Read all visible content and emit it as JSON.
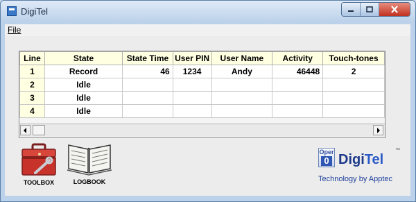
{
  "window": {
    "title": "DigiTel"
  },
  "menu": {
    "file": "File"
  },
  "table": {
    "columns": [
      "Line",
      "State",
      "State Time",
      "User PIN",
      "User Name",
      "Activity",
      "Touch-tones"
    ],
    "rows": [
      {
        "line": "1",
        "state": "Record",
        "state_time": "46",
        "user_pin": "1234",
        "user_name": "Andy",
        "activity": "46448",
        "touch_tones": "2"
      },
      {
        "line": "2",
        "state": "Idle",
        "state_time": "",
        "user_pin": "",
        "user_name": "",
        "activity": "",
        "touch_tones": ""
      },
      {
        "line": "3",
        "state": "Idle",
        "state_time": "",
        "user_pin": "",
        "user_name": "",
        "activity": "",
        "touch_tones": ""
      },
      {
        "line": "4",
        "state": "Idle",
        "state_time": "",
        "user_pin": "",
        "user_name": "",
        "activity": "",
        "touch_tones": ""
      }
    ]
  },
  "tools": {
    "toolbox": "TOOLBOX",
    "logbook": "LOGBOOK"
  },
  "logo": {
    "oper": "Oper",
    "zero": "0",
    "brand_digi": "Digi",
    "brand_tel": "Tel",
    "trademark": "™",
    "byline": "Technology by Apptec"
  },
  "colors": {
    "title_bar": "#bcd2ea",
    "header_bg": "#ffffe1",
    "brand_blue": "#1d3a8a",
    "close_red": "#c0311f"
  },
  "icons": {
    "app": "app-window-icon",
    "minimize": "minimize-icon",
    "maximize": "maximize-icon",
    "close": "close-icon",
    "toolbox": "toolbox-icon",
    "logbook": "logbook-icon"
  }
}
